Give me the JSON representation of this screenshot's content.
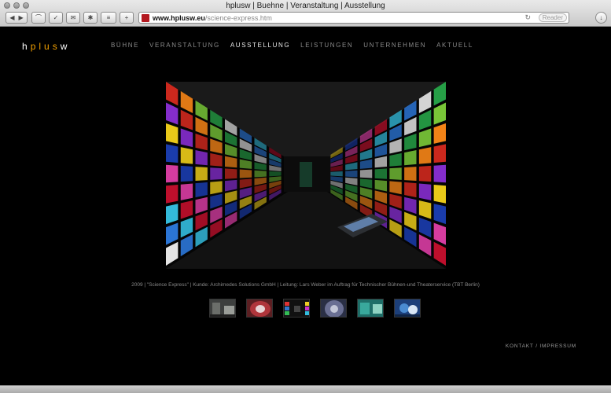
{
  "browser": {
    "window_title": "hplusw | Buehne | Veranstaltung | Ausstellung",
    "url_host": "www.hplusw.eu",
    "url_path": "/science-express.htm",
    "reader_label": "Reader",
    "reload_icon": "↻"
  },
  "site": {
    "logo_letters": [
      "h",
      "p",
      "l",
      "u",
      "s",
      "w"
    ],
    "nav": [
      {
        "label": "BÜHNE",
        "active": false
      },
      {
        "label": "VERANSTALTUNG",
        "active": false
      },
      {
        "label": "AUSSTELLUNG",
        "active": true
      },
      {
        "label": "LEISTUNGEN",
        "active": false
      },
      {
        "label": "UNTERNEHMEN",
        "active": false
      },
      {
        "label": "AKTUELL",
        "active": false
      }
    ],
    "caption": "2009 | \"Science Express\" | Kunde: Archimedes Solutions GmbH | Leitung: Lars Weber im Auftrag für Technischer Bühnen-und Theaterservice (TBT Berlin)",
    "footer": {
      "kontakt": "KONTAKT",
      "separator": "/",
      "impressum": "IMPRESSUM"
    }
  }
}
